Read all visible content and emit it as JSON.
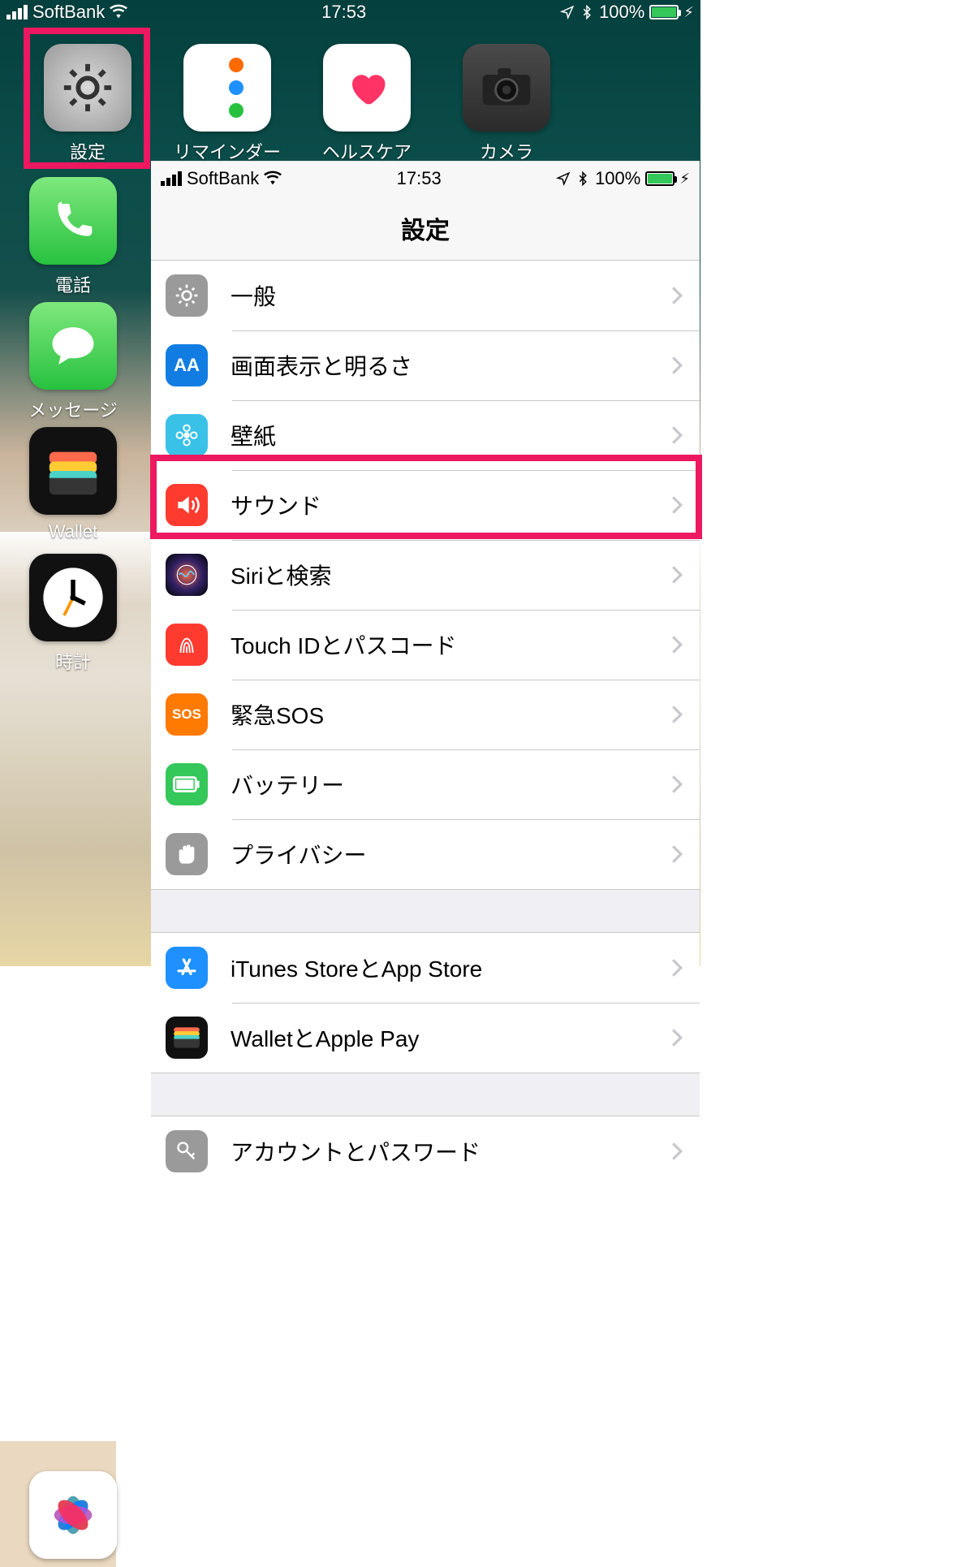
{
  "home_status": {
    "carrier": "SoftBank",
    "time": "17:53",
    "battery": "100%"
  },
  "home_apps": {
    "settings": "設定",
    "reminders": "リマインダー",
    "health": "ヘルスケア",
    "camera": "カメラ",
    "phone": "電話",
    "messages": "メッセージ",
    "wallet": "Wallet",
    "clock": "時計"
  },
  "settings_status": {
    "carrier": "SoftBank",
    "time": "17:53",
    "battery": "100%"
  },
  "settings_title": "設定",
  "rows": {
    "general": "一般",
    "display": "画面表示と明るさ",
    "wallpaper": "壁紙",
    "sound": "サウンド",
    "siri": "Siriと検索",
    "touchid": "Touch IDとパスコード",
    "sos": "緊急SOS",
    "battery": "バッテリー",
    "privacy": "プライバシー",
    "itunes": "iTunes StoreとApp Store",
    "walletpay": "WalletとApple Pay",
    "accounts": "アカウントとパスワード"
  },
  "icon_text": {
    "sos": "SOS",
    "aa": "AA"
  }
}
